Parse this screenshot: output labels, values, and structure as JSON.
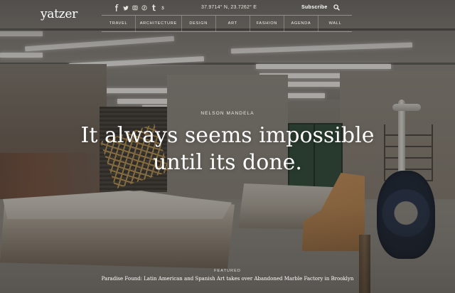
{
  "brand": {
    "logo": "yatzer"
  },
  "header": {
    "social_icons": [
      "facebook-icon",
      "twitter-icon",
      "instagram-icon",
      "pinterest-icon",
      "tumblr-icon",
      "skype-icon"
    ],
    "coordinates": "37.9714° N, 23.7262° E",
    "subscribe_label": "Subscribe",
    "search_icon": "search-icon"
  },
  "nav": {
    "items": [
      {
        "label": "TRAVEL"
      },
      {
        "label": "ARCHITECTURE"
      },
      {
        "label": "DESIGN"
      },
      {
        "label": "ART"
      },
      {
        "label": "FASHION"
      },
      {
        "label": "AGENDA"
      },
      {
        "label": "WALL"
      }
    ]
  },
  "hero": {
    "author": "NELSON MANDELA",
    "quote_line1": "It always seems impossible",
    "quote_line2": "until its done."
  },
  "featured": {
    "label": "FEATURED",
    "title": "Paradise Found: Latin American and Spanish Art takes over Abandoned Marble Factory in Brooklyn"
  },
  "colors": {
    "overlay": "#19161457",
    "text": "#ffffff",
    "nav_border": "#ffffff59"
  }
}
